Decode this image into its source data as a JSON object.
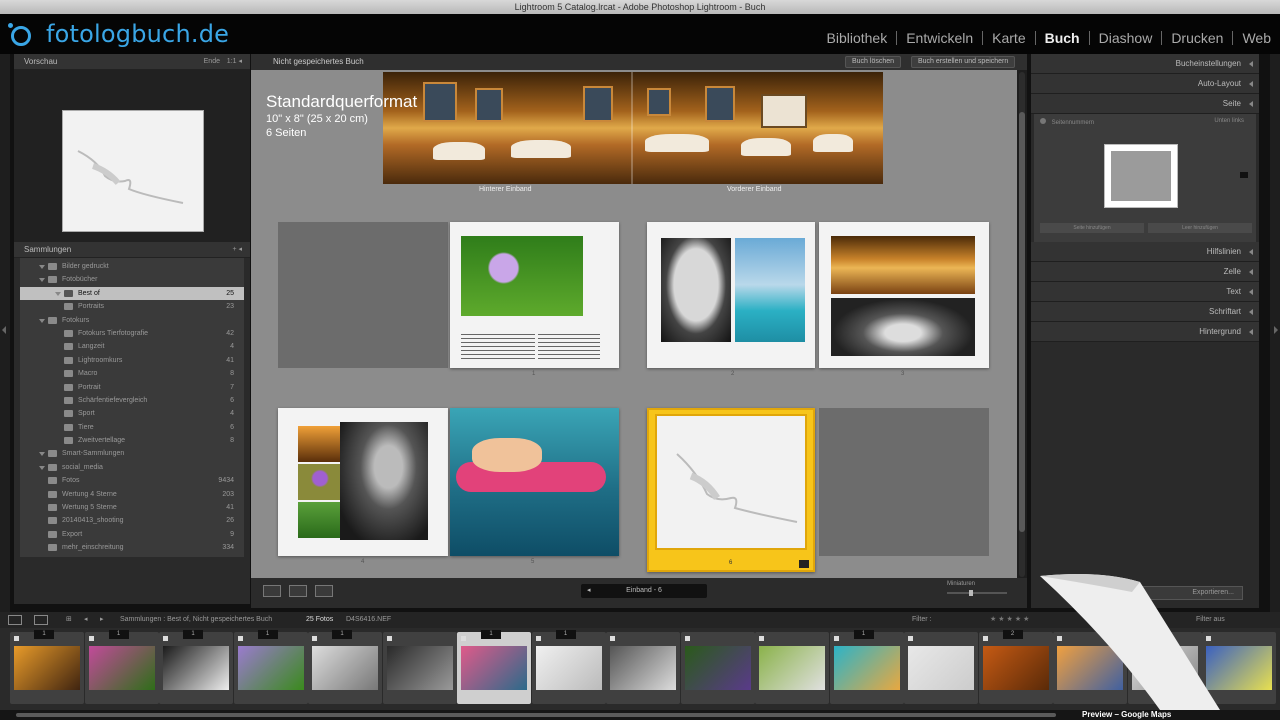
{
  "window": {
    "title": "Lightroom 5 Catalog.lrcat - Adobe Photoshop Lightroom - Buch"
  },
  "logo": {
    "text": "fotologbuch.de"
  },
  "modules": [
    {
      "label": "Bibliothek"
    },
    {
      "label": "Entwickeln"
    },
    {
      "label": "Karte"
    },
    {
      "label": "Buch",
      "active": true
    },
    {
      "label": "Diashow"
    },
    {
      "label": "Drucken"
    },
    {
      "label": "Web"
    }
  ],
  "left": {
    "preview_title": "Vorschau",
    "preview_ctrl": "Ende",
    "collections_title": "Sammlungen",
    "tree": [
      {
        "label": "Bilder gedruckt",
        "level": 1,
        "arrow": true,
        "count": ""
      },
      {
        "label": "Fotobücher",
        "level": 1,
        "arrow": true,
        "count": ""
      },
      {
        "label": "Best of",
        "level": 2,
        "arrow": true,
        "count": "25",
        "selected": true
      },
      {
        "label": "Portraits",
        "level": 2,
        "arrow": false,
        "count": "23"
      },
      {
        "label": "Fotokurs",
        "level": 1,
        "arrow": true,
        "count": ""
      },
      {
        "label": "Fotokurs Tierfotografie",
        "level": 2,
        "arrow": false,
        "count": "42"
      },
      {
        "label": "Langzeit",
        "level": 2,
        "arrow": false,
        "count": "4"
      },
      {
        "label": "Lightroomkurs",
        "level": 2,
        "arrow": false,
        "count": "41"
      },
      {
        "label": "Macro",
        "level": 2,
        "arrow": false,
        "count": "8"
      },
      {
        "label": "Portrait",
        "level": 2,
        "arrow": false,
        "count": "7"
      },
      {
        "label": "Schärfentiefevergleich",
        "level": 2,
        "arrow": false,
        "count": "6"
      },
      {
        "label": "Sport",
        "level": 2,
        "arrow": false,
        "count": "4"
      },
      {
        "label": "Tiere",
        "level": 2,
        "arrow": false,
        "count": "6"
      },
      {
        "label": "Zweitvertellage",
        "level": 2,
        "arrow": false,
        "count": "8"
      },
      {
        "label": "Smart-Sammlungen",
        "level": 1,
        "arrow": true,
        "count": ""
      },
      {
        "label": "social_media",
        "level": 1,
        "arrow": true,
        "count": ""
      },
      {
        "label": "Fotos",
        "level": 1,
        "arrow": false,
        "count": "9434"
      },
      {
        "label": "Wertung 4 Sterne",
        "level": 1,
        "arrow": false,
        "count": "203"
      },
      {
        "label": "Wertung 5 Sterne",
        "level": 1,
        "arrow": false,
        "count": "41"
      },
      {
        "label": "20140413_shooting",
        "level": 1,
        "arrow": false,
        "count": "26"
      },
      {
        "label": "Export",
        "level": 1,
        "arrow": false,
        "count": "9"
      },
      {
        "label": "mehr_einschreitung",
        "level": 1,
        "arrow": false,
        "count": "334"
      }
    ]
  },
  "center": {
    "title": "Nicht gespeichertes Buch",
    "btn_clear": "Buch löschen",
    "btn_save": "Buch erstellen und speichern",
    "format_title": "Standardquerformat",
    "format_size": "10\" x 8\" (25 x 20 cm)",
    "format_pages": "6 Seiten",
    "cover_back": "Hinterer Einband",
    "cover_front": "Vorderer Einband",
    "page_numbers": [
      "1",
      "2",
      "3",
      "4",
      "5",
      "6"
    ],
    "pagenav_label": "Einband - 6",
    "zoom_label": "Miniaturen"
  },
  "right": {
    "sections_top": [
      "Bucheinstellungen",
      "Auto-Layout",
      "Seite"
    ],
    "seite_row": "Seitennummern",
    "seite_row_right": "Unten links",
    "seite_btn_left": "Seite hinzufügen",
    "seite_btn_right": "Leer hinzufügen",
    "sections_bottom": [
      "Hilfslinien",
      "Zelle",
      "Text",
      "Schriftart",
      "Hintergrund"
    ],
    "export_btn": "Exportieren..."
  },
  "filmbar": {
    "path": "Sammlungen : Best of, Nicht gespeichertes Buch",
    "count": "25 Fotos",
    "selected_file": "D4S6416.NEF",
    "filter_label": "Filter :",
    "filter_value": "Filter aus"
  },
  "filmstrip": {
    "cells": [
      {
        "num": "1",
        "colors": [
          "#e89b2a",
          "#402410"
        ]
      },
      {
        "num": "1",
        "colors": [
          "#c24a9a",
          "#2e6e18"
        ]
      },
      {
        "num": "1",
        "colors": [
          "#1a1a1a",
          "#eeeeee"
        ]
      },
      {
        "num": "1",
        "colors": [
          "#9b7bcf",
          "#3a8a1c"
        ]
      },
      {
        "num": "1",
        "colors": [
          "#dddddd",
          "#777777"
        ]
      },
      {
        "num": "",
        "colors": [
          "#2a2a2a",
          "#9a9a9a"
        ]
      },
      {
        "num": "1",
        "colors": [
          "#e05a8a",
          "#2b6a8a"
        ],
        "selected": true
      },
      {
        "num": "1",
        "colors": [
          "#f0f0f0",
          "#bbbbbb"
        ]
      },
      {
        "num": "",
        "colors": [
          "#555555",
          "#dddddd"
        ]
      },
      {
        "num": "",
        "colors": [
          "#2a5a1a",
          "#5a3a8a"
        ]
      },
      {
        "num": "",
        "colors": [
          "#8ab24a",
          "#e0e0e0"
        ]
      },
      {
        "num": "1",
        "colors": [
          "#2cb3c8",
          "#e8a840"
        ]
      },
      {
        "num": "",
        "colors": [
          "#e8e8e8",
          "#cccccc"
        ]
      },
      {
        "num": "2",
        "colors": [
          "#c55a14",
          "#5a2a08"
        ]
      },
      {
        "num": "",
        "colors": [
          "#f0a040",
          "#4060a0"
        ]
      },
      {
        "num": "",
        "colors": [
          "#dddddd",
          "#888888"
        ]
      },
      {
        "num": "",
        "colors": [
          "#3a60c0",
          "#e8e050"
        ]
      }
    ]
  },
  "overlay": {
    "maps_label": "Preview – Google Maps"
  }
}
